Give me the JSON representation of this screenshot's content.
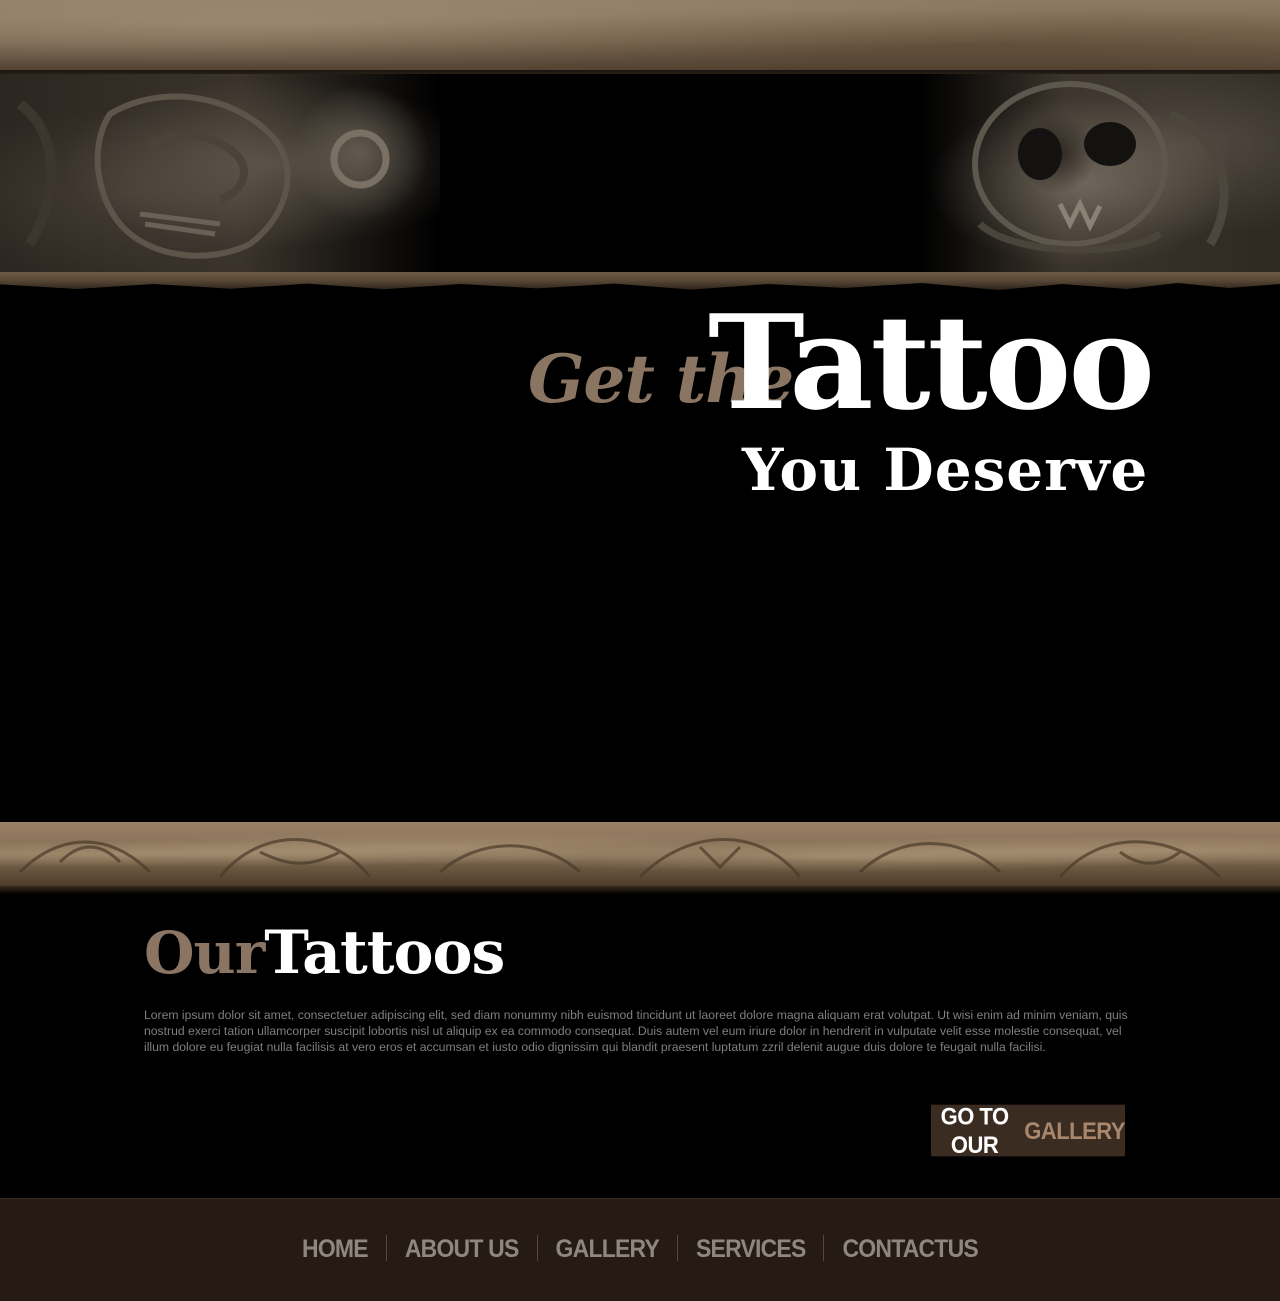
{
  "hero": {
    "prefix": "Get the",
    "word": "Tattoo",
    "suffix": "You Deserve"
  },
  "section": {
    "title_accent": "Our",
    "title_main": "Tattoos",
    "body": "Lorem ipsum dolor sit amet, consectetuer adipiscing elit, sed diam nonummy nibh euismod tincidunt ut laoreet dolore magna aliquam erat volutpat. Ut wisi enim ad minim veniam, quis nostrud exerci tation ullamcorper suscipit lobortis nisl ut aliquip ex ea commodo consequat. Duis autem vel eum iriure dolor in hendrerit in vulputate velit esse molestie consequat, vel illum dolore eu feugiat nulla facilisis at vero eros et accumsan et iusto odio dignissim qui blandit praesent luptatum zzril delenit augue duis dolore te feugait nulla facilisi."
  },
  "gallery_button": {
    "label_main": "GO TO OUR",
    "label_accent": "GALLERY"
  },
  "footer_nav": [
    {
      "label": "HOME"
    },
    {
      "label": "ABOUT US"
    },
    {
      "label": "GALLERY"
    },
    {
      "label": "SERVICES"
    },
    {
      "label": "CONTACTUS"
    }
  ],
  "colors": {
    "accent": "#8a7462",
    "button_bg": "#3b2c22",
    "footer_bg": "#251b14",
    "nav_text": "#8e8780",
    "body_text": "#7f7f7f"
  }
}
